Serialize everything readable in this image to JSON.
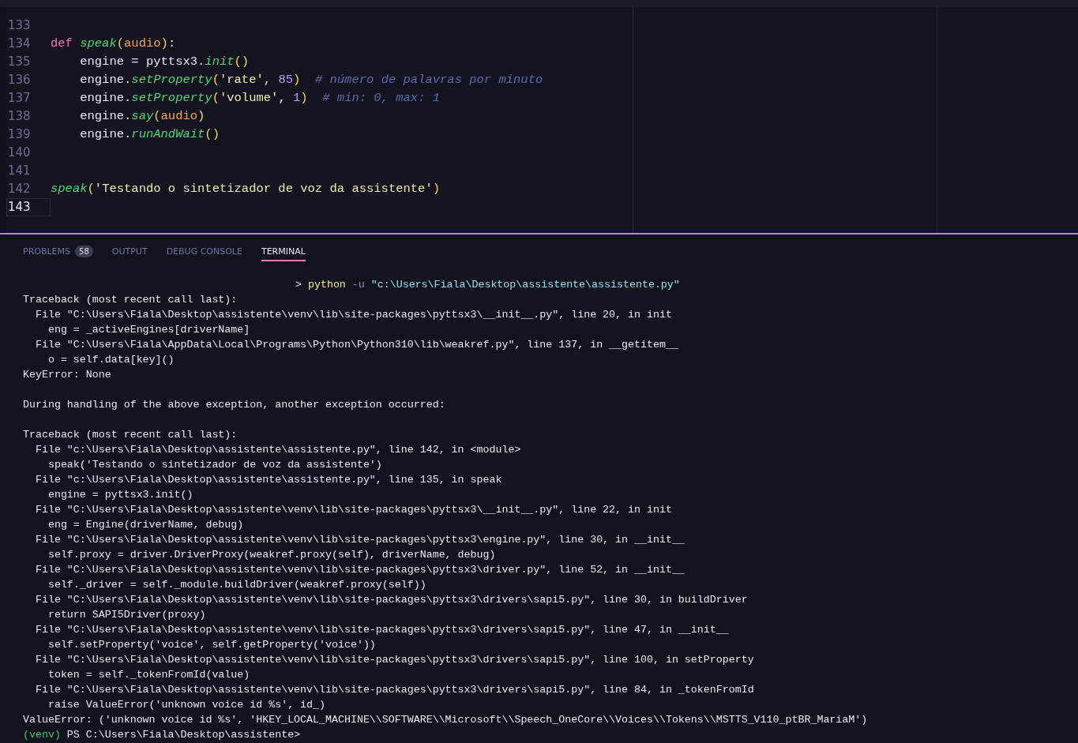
{
  "editor": {
    "lines": [
      {
        "number": "133",
        "current": false
      },
      {
        "number": "134",
        "current": false,
        "tokens": [
          {
            "kind": "keyword",
            "text": "def "
          },
          {
            "kind": "function",
            "text": "speak"
          },
          {
            "kind": "paren",
            "text": "("
          },
          {
            "kind": "param",
            "text": "audio"
          },
          {
            "kind": "paren",
            "text": ")"
          },
          {
            "kind": "plain",
            "text": ":"
          }
        ]
      },
      {
        "number": "135",
        "current": false,
        "tokens": [
          {
            "kind": "plain",
            "text": "    engine = pyttsx3."
          },
          {
            "kind": "function",
            "text": "init"
          },
          {
            "kind": "paren",
            "text": "()"
          }
        ]
      },
      {
        "number": "136",
        "current": false,
        "tokens": [
          {
            "kind": "plain",
            "text": "    engine."
          },
          {
            "kind": "function",
            "text": "setProperty"
          },
          {
            "kind": "paren",
            "text": "("
          },
          {
            "kind": "string",
            "text": "'rate'"
          },
          {
            "kind": "plain",
            "text": ", "
          },
          {
            "kind": "number",
            "text": "85"
          },
          {
            "kind": "paren",
            "text": ")"
          },
          {
            "kind": "comment",
            "text": "  # número de palavras por minuto"
          }
        ]
      },
      {
        "number": "137",
        "current": false,
        "tokens": [
          {
            "kind": "plain",
            "text": "    engine."
          },
          {
            "kind": "function",
            "text": "setProperty"
          },
          {
            "kind": "paren",
            "text": "("
          },
          {
            "kind": "string",
            "text": "'volume'"
          },
          {
            "kind": "plain",
            "text": ", "
          },
          {
            "kind": "number",
            "text": "1"
          },
          {
            "kind": "paren",
            "text": ")"
          },
          {
            "kind": "comment",
            "text": "  # min: 0, max: 1"
          }
        ]
      },
      {
        "number": "138",
        "current": false,
        "tokens": [
          {
            "kind": "plain",
            "text": "    engine."
          },
          {
            "kind": "function",
            "text": "say"
          },
          {
            "kind": "paren",
            "text": "("
          },
          {
            "kind": "param",
            "text": "audio"
          },
          {
            "kind": "paren",
            "text": ")"
          }
        ]
      },
      {
        "number": "139",
        "current": false,
        "tokens": [
          {
            "kind": "plain",
            "text": "    engine."
          },
          {
            "kind": "function",
            "text": "runAndWait"
          },
          {
            "kind": "paren",
            "text": "()"
          }
        ]
      },
      {
        "number": "140",
        "current": false
      },
      {
        "number": "141",
        "current": false
      },
      {
        "number": "142",
        "current": false,
        "tokens": [
          {
            "kind": "function",
            "text": "speak"
          },
          {
            "kind": "paren",
            "text": "("
          },
          {
            "kind": "string",
            "text": "'Testando o sintetizador de voz da assistente'"
          },
          {
            "kind": "paren",
            "text": ")"
          }
        ]
      },
      {
        "number": "143",
        "current": true
      }
    ]
  },
  "panel": {
    "tabs": [
      {
        "label": "PROBLEMS",
        "badge": "58",
        "selected": false
      },
      {
        "label": "OUTPUT",
        "selected": false
      },
      {
        "label": "DEBUG CONSOLE",
        "selected": false
      },
      {
        "label": "TERMINAL",
        "selected": true
      }
    ],
    "terminal": [
      {
        "kind": "command",
        "segments": [
          {
            "kind": "plain",
            "text": "> "
          },
          {
            "kind": "exe",
            "text": "python"
          },
          {
            "kind": "flag",
            "text": " -u "
          },
          {
            "kind": "path",
            "text": "\"c:\\Users\\Fiala\\Desktop\\assistente\\assistente.py\""
          }
        ]
      },
      {
        "kind": "output",
        "segments": [
          {
            "kind": "plain",
            "text": "Traceback (most recent call last):"
          }
        ]
      },
      {
        "kind": "output",
        "segments": [
          {
            "kind": "plain",
            "text": "  File \"C:\\Users\\Fiala\\Desktop\\assistente\\venv\\lib\\site-packages\\pyttsx3\\__init__.py\", line 20, in init"
          }
        ]
      },
      {
        "kind": "output",
        "segments": [
          {
            "kind": "plain",
            "text": "    eng = _activeEngines[driverName]"
          }
        ]
      },
      {
        "kind": "output",
        "segments": [
          {
            "kind": "plain",
            "text": "  File \"C:\\Users\\Fiala\\AppData\\Local\\Programs\\Python\\Python310\\lib\\weakref.py\", line 137, in __getitem__"
          }
        ]
      },
      {
        "kind": "output",
        "segments": [
          {
            "kind": "plain",
            "text": "    o = self.data[key]()"
          }
        ]
      },
      {
        "kind": "output",
        "segments": [
          {
            "kind": "plain",
            "text": "KeyError: None"
          }
        ]
      },
      {
        "kind": "blank"
      },
      {
        "kind": "output",
        "segments": [
          {
            "kind": "plain",
            "text": "During handling of the above exception, another exception occurred:"
          }
        ]
      },
      {
        "kind": "blank"
      },
      {
        "kind": "output",
        "segments": [
          {
            "kind": "plain",
            "text": "Traceback (most recent call last):"
          }
        ]
      },
      {
        "kind": "output",
        "segments": [
          {
            "kind": "plain",
            "text": "  File \"c:\\Users\\Fiala\\Desktop\\assistente\\assistente.py\", line 142, in <module>"
          }
        ]
      },
      {
        "kind": "output",
        "segments": [
          {
            "kind": "plain",
            "text": "    speak('Testando o sintetizador de voz da assistente')"
          }
        ]
      },
      {
        "kind": "output",
        "segments": [
          {
            "kind": "plain",
            "text": "  File \"c:\\Users\\Fiala\\Desktop\\assistente\\assistente.py\", line 135, in speak"
          }
        ]
      },
      {
        "kind": "output",
        "segments": [
          {
            "kind": "plain",
            "text": "    engine = pyttsx3.init()"
          }
        ]
      },
      {
        "kind": "output",
        "segments": [
          {
            "kind": "plain",
            "text": "  File \"C:\\Users\\Fiala\\Desktop\\assistente\\venv\\lib\\site-packages\\pyttsx3\\__init__.py\", line 22, in init"
          }
        ]
      },
      {
        "kind": "output",
        "segments": [
          {
            "kind": "plain",
            "text": "    eng = Engine(driverName, debug)"
          }
        ]
      },
      {
        "kind": "output",
        "segments": [
          {
            "kind": "plain",
            "text": "  File \"C:\\Users\\Fiala\\Desktop\\assistente\\venv\\lib\\site-packages\\pyttsx3\\engine.py\", line 30, in __init__"
          }
        ]
      },
      {
        "kind": "output",
        "segments": [
          {
            "kind": "plain",
            "text": "    self.proxy = driver.DriverProxy(weakref.proxy(self), driverName, debug)"
          }
        ]
      },
      {
        "kind": "output",
        "segments": [
          {
            "kind": "plain",
            "text": "  File \"C:\\Users\\Fiala\\Desktop\\assistente\\venv\\lib\\site-packages\\pyttsx3\\driver.py\", line 52, in __init__"
          }
        ]
      },
      {
        "kind": "output",
        "segments": [
          {
            "kind": "plain",
            "text": "    self._driver = self._module.buildDriver(weakref.proxy(self))"
          }
        ]
      },
      {
        "kind": "output",
        "segments": [
          {
            "kind": "plain",
            "text": "  File \"C:\\Users\\Fiala\\Desktop\\assistente\\venv\\lib\\site-packages\\pyttsx3\\drivers\\sapi5.py\", line 30, in buildDriver"
          }
        ]
      },
      {
        "kind": "output",
        "segments": [
          {
            "kind": "plain",
            "text": "    return SAPI5Driver(proxy)"
          }
        ]
      },
      {
        "kind": "output",
        "segments": [
          {
            "kind": "plain",
            "text": "  File \"C:\\Users\\Fiala\\Desktop\\assistente\\venv\\lib\\site-packages\\pyttsx3\\drivers\\sapi5.py\", line 47, in __init__"
          }
        ]
      },
      {
        "kind": "output",
        "segments": [
          {
            "kind": "plain",
            "text": "    self.setProperty('voice', self.getProperty('voice'))"
          }
        ]
      },
      {
        "kind": "output",
        "segments": [
          {
            "kind": "plain",
            "text": "  File \"C:\\Users\\Fiala\\Desktop\\assistente\\venv\\lib\\site-packages\\pyttsx3\\drivers\\sapi5.py\", line 100, in setProperty"
          }
        ]
      },
      {
        "kind": "output",
        "segments": [
          {
            "kind": "plain",
            "text": "    token = self._tokenFromId(value)"
          }
        ]
      },
      {
        "kind": "output",
        "segments": [
          {
            "kind": "plain",
            "text": "  File \"C:\\Users\\Fiala\\Desktop\\assistente\\venv\\lib\\site-packages\\pyttsx3\\drivers\\sapi5.py\", line 84, in _tokenFromId"
          }
        ]
      },
      {
        "kind": "output",
        "segments": [
          {
            "kind": "plain",
            "text": "    raise ValueError('unknown voice id %s', id_)"
          }
        ]
      },
      {
        "kind": "output",
        "segments": [
          {
            "kind": "plain",
            "text": "ValueError: ('unknown voice id %s', 'HKEY_LOCAL_MACHINE\\\\SOFTWARE\\\\Microsoft\\\\Speech_OneCore\\\\Voices\\\\Tokens\\\\MSTTS_V110_ptBR_MariaM')"
          }
        ]
      },
      {
        "kind": "prompt",
        "segments": [
          {
            "kind": "venv",
            "text": "(venv)"
          },
          {
            "kind": "plain",
            "text": " PS C:\\Users\\Fiala\\Desktop\\assistente>"
          }
        ]
      }
    ]
  }
}
